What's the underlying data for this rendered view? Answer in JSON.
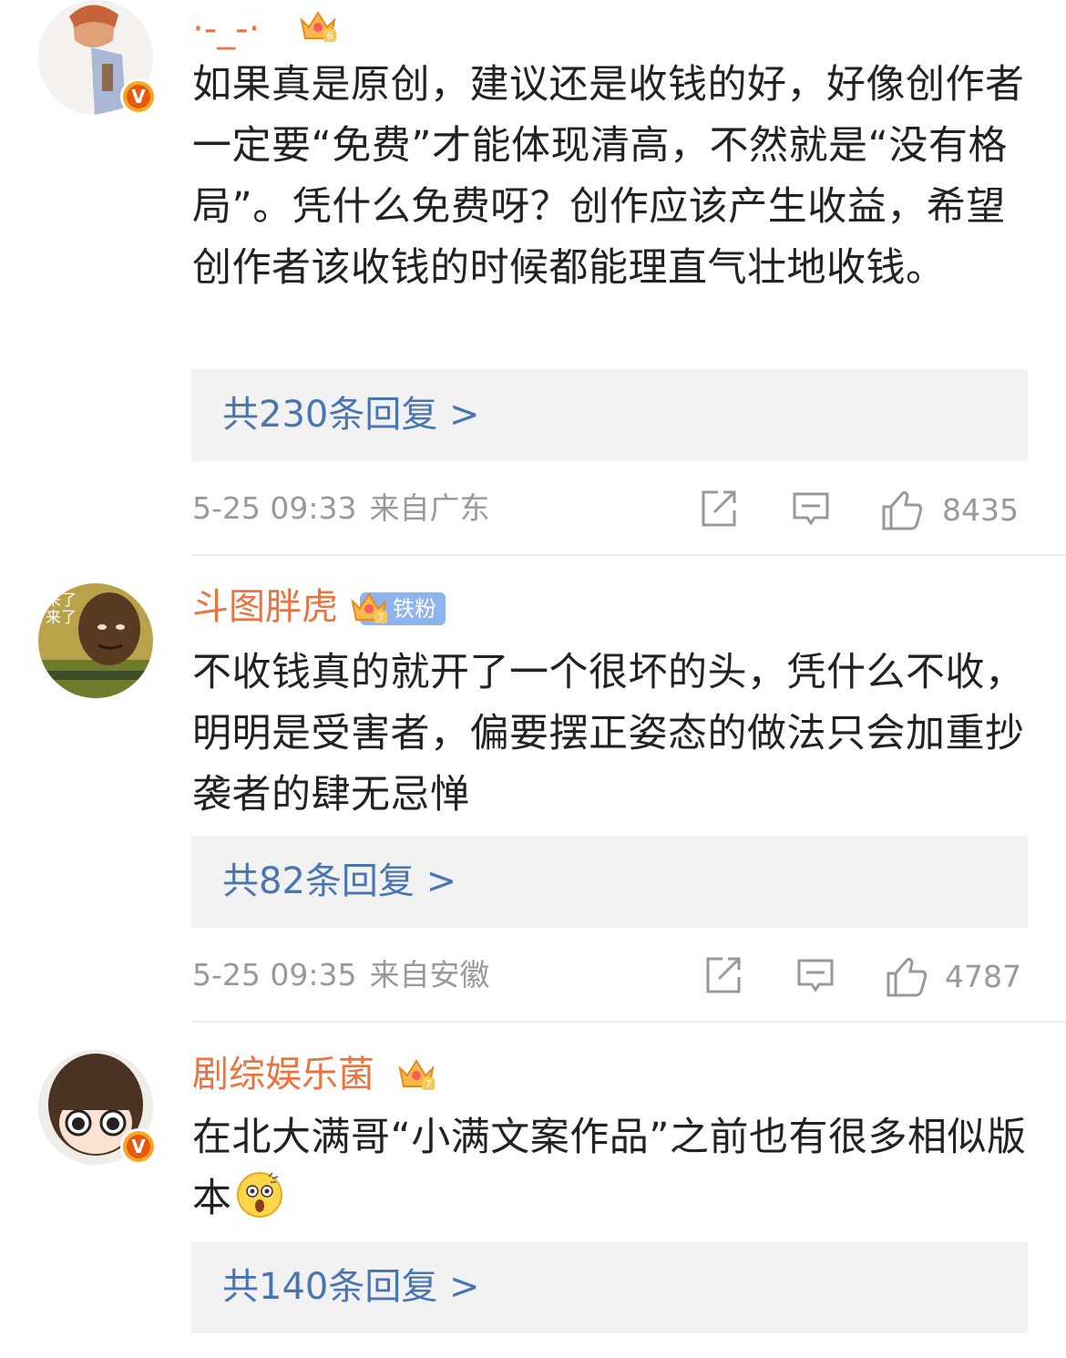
{
  "colors": {
    "username": "#eb7340",
    "body_text": "#222222",
    "reply_link": "#4a75b3",
    "reply_bg": "#f2f2f2",
    "meta": "#999999",
    "verified_badge": "#e8580c",
    "fan_badge": "#8db4ef"
  },
  "comments": [
    {
      "username": "·-_-·",
      "badge_icon": "crown-level-6-icon",
      "verified": true,
      "text": "如果真是原创，建议还是收钱的好，好像创作者一定要“免费”才能体现清高，不然就是“没有格局”。凭什么免费呀？创作应该产生收益，希望创作者该收钱的时候都能理直气壮地收钱。",
      "replies_label": "共230条回复 >",
      "time": "5-25 09:33",
      "location": "来自广东",
      "likes": "8435"
    },
    {
      "username": "斗图胖虎",
      "badge_icon": "crown-level-7-icon",
      "fan_badge": "铁粉",
      "avatar_caption": "来了\n来了",
      "verified": false,
      "text": "不收钱真的就开了一个很坏的头，凭什么不收，明明是受害者，偏要摆正姿态的做法只会加重抄袭者的肆无忌惮",
      "replies_label": "共82条回复 >",
      "time": "5-25 09:35",
      "location": "来自安徽",
      "likes": "4787"
    },
    {
      "username": "剧综娱乐菌",
      "badge_icon": "crown-level-7-icon",
      "verified": true,
      "text": "在北大满哥“小满文案作品”之前也有很多相似版本",
      "emoji": "shocked-face-emoji",
      "replies_label": "共140条回复 >"
    }
  ]
}
